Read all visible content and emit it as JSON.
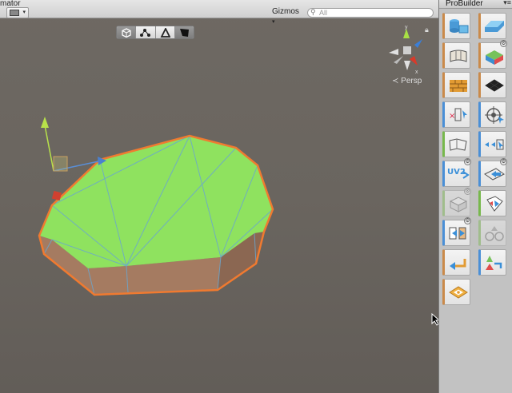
{
  "scene": {
    "tab_label": "mator",
    "gizmos_label": "Gizmos",
    "gizmos_caret": "▾",
    "search_placeholder": "All",
    "projection_label": "Persp",
    "axis_labels": {
      "y": "y",
      "x": "x"
    }
  },
  "select_modes": [
    {
      "name": "object-mode-button",
      "icon": "cube-icon",
      "active": true
    },
    {
      "name": "vertex-mode-button",
      "icon": "vertex-icon",
      "active": false
    },
    {
      "name": "edge-mode-button",
      "icon": "edge-icon",
      "active": false
    },
    {
      "name": "face-mode-button",
      "icon": "face-icon",
      "active": true
    }
  ],
  "probuilder": {
    "title": "ProBuilder",
    "menu_glyph": "▾≡",
    "uv_text": "UV2"
  },
  "colors": {
    "mesh_top": "#8fe25f",
    "mesh_side": "#a57b61",
    "selection_outline": "#f07a30",
    "wire": "#6aa6cf",
    "accent_blue": "#3a8fd8",
    "tool_orange": "#ca8a4a",
    "tool_green": "#77b84c"
  }
}
